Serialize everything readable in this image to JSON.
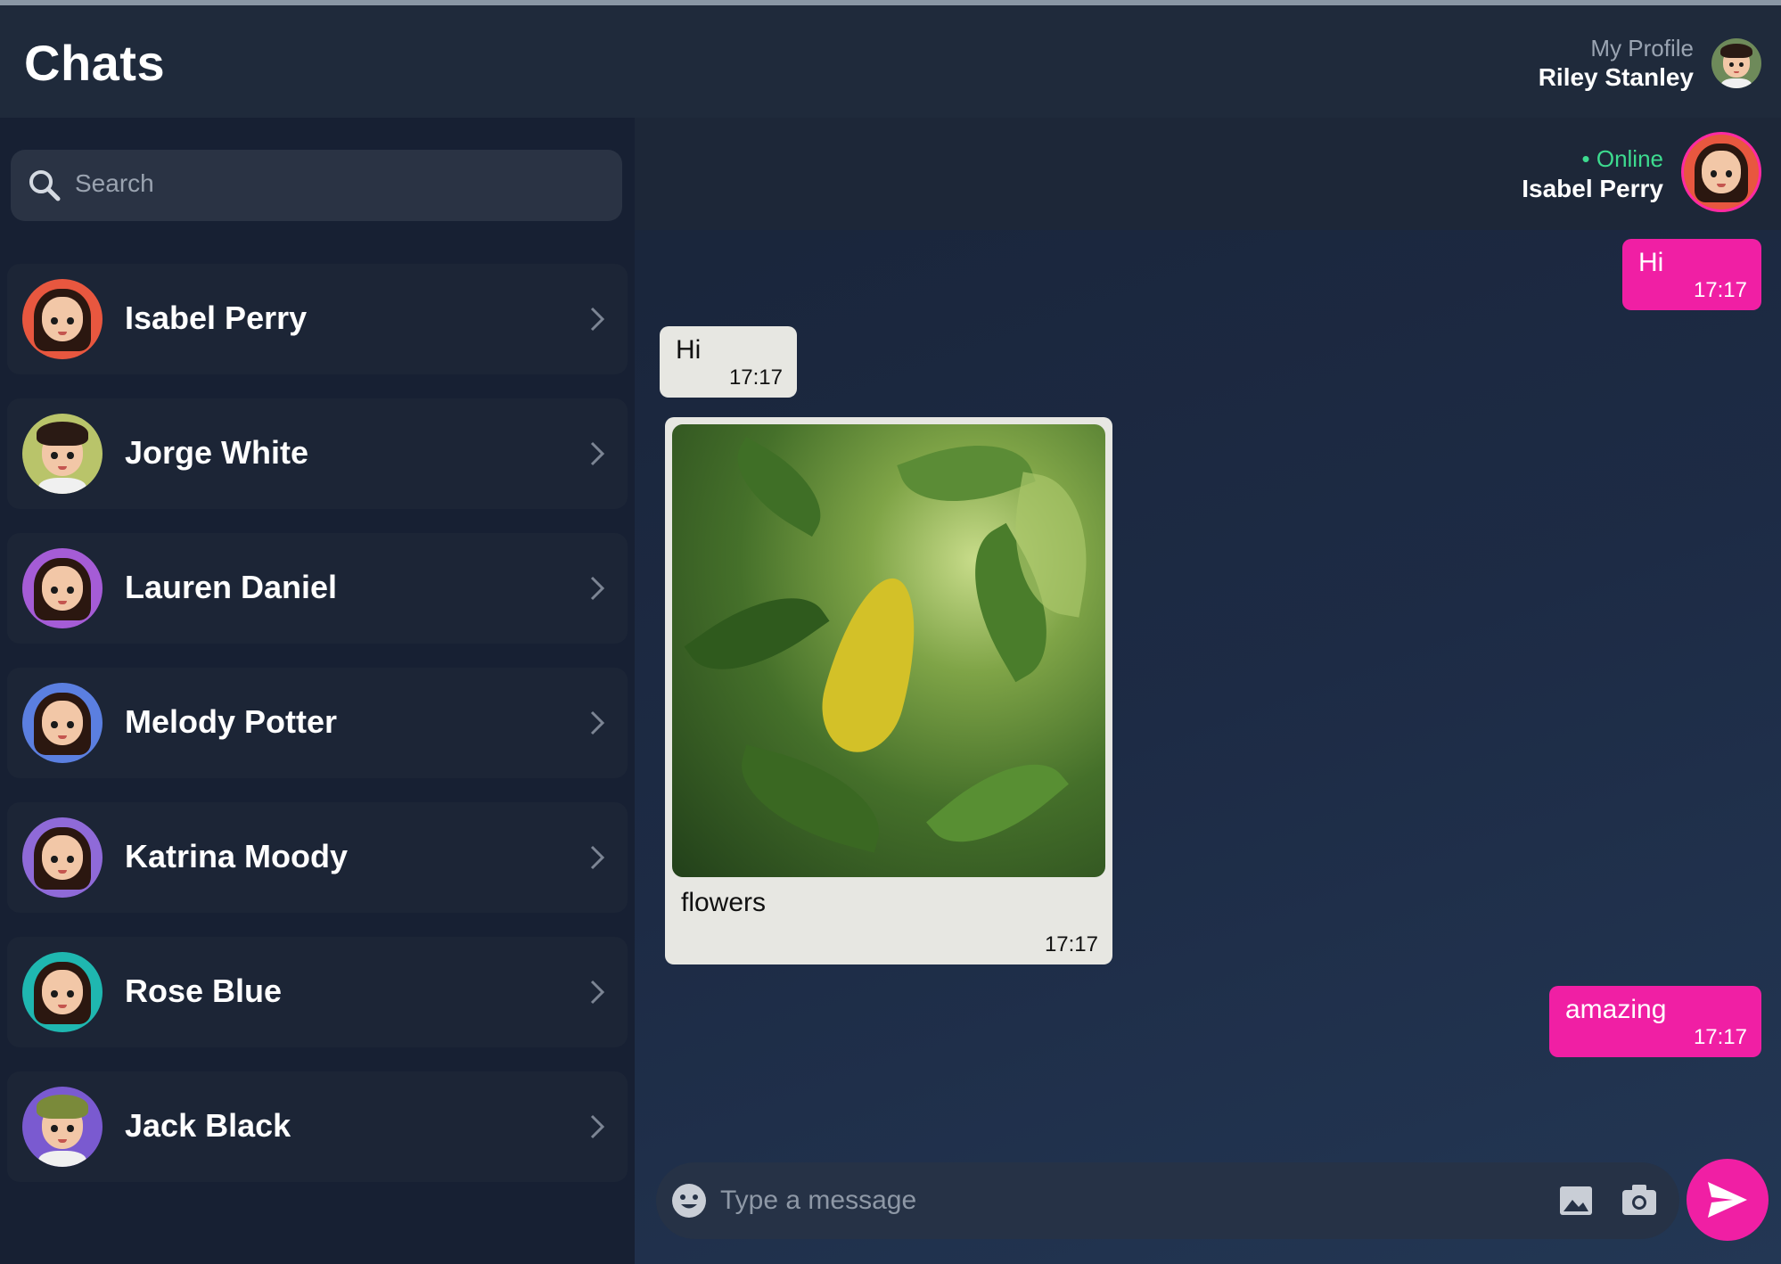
{
  "header": {
    "title": "Chats",
    "profile_label": "My Profile",
    "profile_name": "Riley Stanley"
  },
  "search": {
    "placeholder": "Search"
  },
  "contacts": [
    {
      "name": "Isabel Perry",
      "avatar_color": "#e8573f"
    },
    {
      "name": "Jorge White",
      "avatar_color": "#b9c46a"
    },
    {
      "name": "Lauren Daniel",
      "avatar_color": "#a55cd6"
    },
    {
      "name": "Melody Potter",
      "avatar_color": "#5b7fe0"
    },
    {
      "name": "Katrina Moody",
      "avatar_color": "#8f6ad8"
    },
    {
      "name": "Rose Blue",
      "avatar_color": "#1fb7b0"
    },
    {
      "name": "Jack Black",
      "avatar_color": "#7a5ad0"
    }
  ],
  "chat": {
    "status": "• Online",
    "contact_name": "Isabel Perry",
    "messages": [
      {
        "direction": "out",
        "text": "Hi",
        "time": "17:17"
      },
      {
        "direction": "in",
        "text": "Hi",
        "time": "17:17"
      },
      {
        "direction": "in",
        "type": "image",
        "caption": "flowers",
        "time": "17:17"
      },
      {
        "direction": "out",
        "text": "amazing",
        "time": "17:17"
      }
    ],
    "composer_placeholder": "Type a message"
  },
  "colors": {
    "accent": "#f01fa4",
    "online": "#3ddb8f",
    "background": "#1b2435"
  },
  "icons": [
    "search-icon",
    "chevron-right-icon",
    "emoji-icon",
    "image-icon",
    "camera-icon",
    "send-icon"
  ]
}
